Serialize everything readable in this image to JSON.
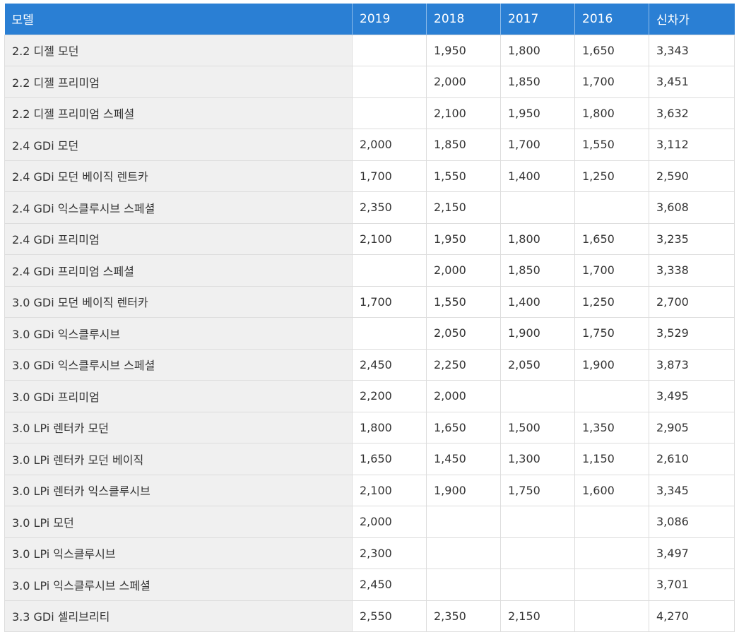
{
  "table": {
    "headers": [
      "모델",
      "2019",
      "2018",
      "2017",
      "2016",
      "신차가"
    ],
    "rows": [
      [
        "2.2 디젤 모던",
        "",
        "1,950",
        "1,800",
        "1,650",
        "3,343"
      ],
      [
        "2.2 디젤 프리미엄",
        "",
        "2,000",
        "1,850",
        "1,700",
        "3,451"
      ],
      [
        "2.2 디젤 프리미엄 스페셜",
        "",
        "2,100",
        "1,950",
        "1,800",
        "3,632"
      ],
      [
        "2.4 GDi 모던",
        "2,000",
        "1,850",
        "1,700",
        "1,550",
        "3,112"
      ],
      [
        "2.4 GDi 모던 베이직 렌트카",
        "1,700",
        "1,550",
        "1,400",
        "1,250",
        "2,590"
      ],
      [
        "2.4 GDi 익스클루시브 스페셜",
        "2,350",
        "2,150",
        "",
        "",
        "3,608"
      ],
      [
        "2.4 GDi 프리미엄",
        "2,100",
        "1,950",
        "1,800",
        "1,650",
        "3,235"
      ],
      [
        "2.4 GDi 프리미엄 스페셜",
        "",
        "2,000",
        "1,850",
        "1,700",
        "3,338"
      ],
      [
        "3.0 GDi 모던 베이직 렌터카",
        "1,700",
        "1,550",
        "1,400",
        "1,250",
        "2,700"
      ],
      [
        "3.0 GDi 익스클루시브",
        "",
        "2,050",
        "1,900",
        "1,750",
        "3,529"
      ],
      [
        "3.0 GDi 익스클루시브 스페셜",
        "2,450",
        "2,250",
        "2,050",
        "1,900",
        "3,873"
      ],
      [
        "3.0 GDi 프리미엄",
        "2,200",
        "2,000",
        "",
        "",
        "3,495"
      ],
      [
        "3.0 LPi 렌터카 모던",
        "1,800",
        "1,650",
        "1,500",
        "1,350",
        "2,905"
      ],
      [
        "3.0 LPi 렌터카 모던 베이직",
        "1,650",
        "1,450",
        "1,300",
        "1,150",
        "2,610"
      ],
      [
        "3.0 LPi 렌터카 익스클루시브",
        "2,100",
        "1,900",
        "1,750",
        "1,600",
        "3,345"
      ],
      [
        "3.0 LPi 모던",
        "2,000",
        "",
        "",
        "",
        "3,086"
      ],
      [
        "3.0 LPi 익스클루시브",
        "2,300",
        "",
        "",
        "",
        "3,497"
      ],
      [
        "3.0 LPi 익스클루시브 스페셜",
        "2,450",
        "",
        "",
        "",
        "3,701"
      ],
      [
        "3.3 GDi 셀리브리티",
        "2,550",
        "2,350",
        "2,150",
        "",
        "4,270"
      ]
    ]
  },
  "colors": {
    "header_bg": "#2a7fd4",
    "header_text": "#ffffff",
    "first_col_bg": "#f0f0f0",
    "border": "#dddddd",
    "text": "#333333"
  }
}
